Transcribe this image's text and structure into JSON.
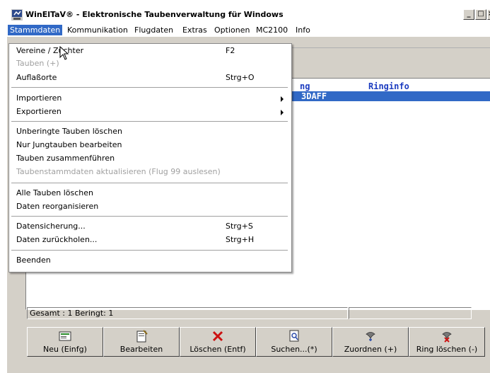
{
  "window": {
    "title": "WinElTaV® - Elektronische Taubenverwaltung für Windows",
    "btn_min": "_",
    "btn_max": "□",
    "btn_close": "×"
  },
  "menubar": {
    "items": [
      "Stammdaten",
      "Kommunikation",
      "Flugdaten",
      "Extras",
      "Optionen",
      "MC2100",
      "Info"
    ]
  },
  "dropdown": {
    "items": [
      {
        "label": "Vereine / Züchter",
        "shortcut": "F2"
      },
      {
        "label": "Tauben (+)",
        "disabled": true
      },
      {
        "label": "Auflaßorte",
        "shortcut": "Strg+O"
      },
      {
        "label": "Importieren",
        "submenu": true
      },
      {
        "label": "Exportieren",
        "submenu": true
      },
      {
        "label": "Unberingte Tauben löschen"
      },
      {
        "label": "Nur Jungtauben bearbeiten"
      },
      {
        "label": "Tauben zusammenführen"
      },
      {
        "label": "Taubenstammdaten aktualisieren (Flug 99 auslesen)",
        "disabled": true
      },
      {
        "label": "Alle Tauben löschen"
      },
      {
        "label": "Daten reorganisieren"
      },
      {
        "label": "Datensicherung...",
        "shortcut": "Strg+S"
      },
      {
        "label": "Daten zurückholen...",
        "shortcut": "Strg+H"
      },
      {
        "label": "Beenden"
      }
    ]
  },
  "list": {
    "headers": [
      "ng",
      "Ringinfo"
    ],
    "row_text": "3DAFF"
  },
  "status": {
    "summary": "Gesamt : 1  Beringt: 1"
  },
  "buttons": [
    {
      "label": "Neu (Einfg)",
      "icon": "new-record-icon"
    },
    {
      "label": "Bearbeiten",
      "icon": "edit-icon"
    },
    {
      "label": "Löschen (Entf)",
      "icon": "delete-x-icon"
    },
    {
      "label": "Suchen...(*)",
      "icon": "search-document-icon"
    },
    {
      "label": "Zuordnen (+)",
      "icon": "assign-pigeon-icon"
    },
    {
      "label": "Ring löschen (-)",
      "icon": "ring-delete-icon"
    }
  ],
  "colors": {
    "menu_highlight": "#3169c6",
    "list_header_text": "#1c3cc0",
    "delete_red": "#cc1111"
  }
}
